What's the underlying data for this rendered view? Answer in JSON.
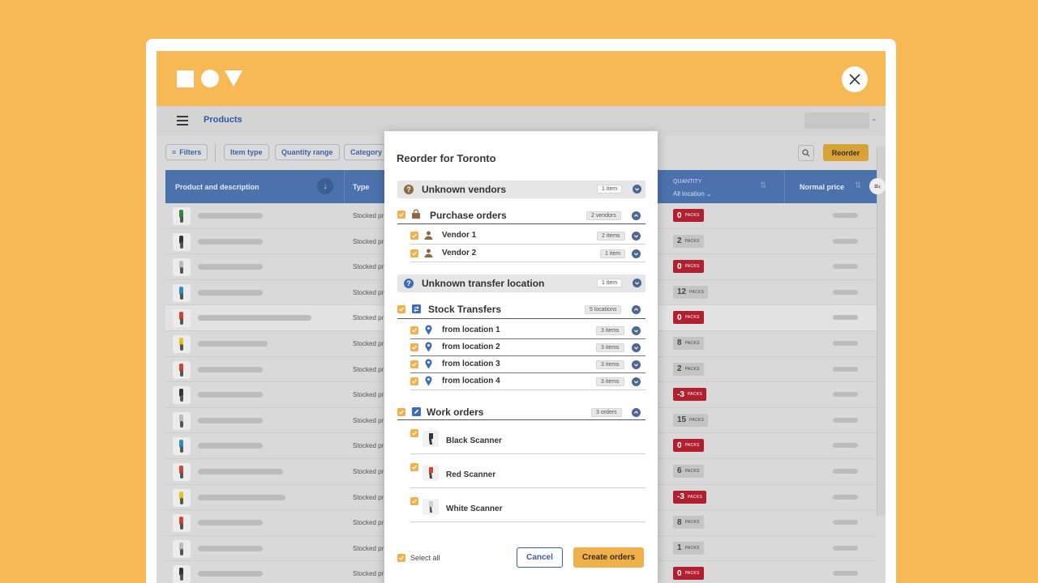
{
  "app": {
    "page_title": "Products"
  },
  "filters": {
    "filters_label": "Filters",
    "item_type_label": "Item type",
    "quantity_range_label": "Quantity range",
    "category_label": "Category",
    "reorder_label": "Reorder"
  },
  "table": {
    "col_product": "Product and description",
    "col_type": "Type",
    "col_quantity_small": "QUANTITY",
    "col_quantity_main": "All location",
    "col_price": "Normal price",
    "pack_unit": "PACKS",
    "rows": [
      {
        "type": "Stocked pr",
        "qty": "0",
        "status": "red",
        "color": "#2e8b3e"
      },
      {
        "type": "Stocked pr",
        "qty": "2",
        "status": "gray",
        "color": "#333333"
      },
      {
        "type": "Stocked pr",
        "qty": "0",
        "status": "red",
        "color": "#bbbbbb"
      },
      {
        "type": "Stocked pr",
        "qty": "12",
        "status": "gray",
        "color": "#2d8fc9"
      },
      {
        "type": "Stocked pr",
        "qty": "0",
        "status": "red",
        "color": "#d8432c"
      },
      {
        "type": "Stocked pr",
        "qty": "8",
        "status": "gray",
        "color": "#e6c21c"
      },
      {
        "type": "Stocked pr",
        "qty": "2",
        "status": "gray",
        "color": "#d8432c"
      },
      {
        "type": "Stocked pr",
        "qty": "-3",
        "status": "red",
        "color": "#333333"
      },
      {
        "type": "Stocked pr",
        "qty": "15",
        "status": "gray",
        "color": "#bbbbbb"
      },
      {
        "type": "Stocked pr",
        "qty": "0",
        "status": "red",
        "color": "#2d8fc9"
      },
      {
        "type": "Stocked pr",
        "qty": "6",
        "status": "gray",
        "color": "#d8432c"
      },
      {
        "type": "Stocked pr",
        "qty": "-3",
        "status": "red",
        "color": "#e6c21c"
      },
      {
        "type": "Stocked pr",
        "qty": "8",
        "status": "gray",
        "color": "#d8432c"
      },
      {
        "type": "Stocked pr",
        "qty": "1",
        "status": "gray",
        "color": "#bbbbbb"
      },
      {
        "type": "Stocked pr",
        "qty": "0",
        "status": "red",
        "color": "#333333"
      }
    ]
  },
  "modal": {
    "title": "Reorder for Toronto",
    "unknown_vendors": {
      "label": "Unknown vendors",
      "badge": "1 item"
    },
    "purchase_orders": {
      "label": "Purchase orders",
      "badge": "2 vendors"
    },
    "vendors": [
      {
        "label": "Vendor 1",
        "badge": "2 items"
      },
      {
        "label": "Vendor 2",
        "badge": "1 item"
      }
    ],
    "unknown_transfer": {
      "label": "Unknown transfer location",
      "badge": "1 item"
    },
    "stock_transfers": {
      "label": "Stock Transfers",
      "badge": "5 locations"
    },
    "locations": [
      {
        "label": "from location 1",
        "badge": "3 items"
      },
      {
        "label": "from location 2",
        "badge": "3 items"
      },
      {
        "label": "from location 3",
        "badge": "3 items"
      },
      {
        "label": "from location 4",
        "badge": "3 items"
      }
    ],
    "work_orders": {
      "label": "Work orders",
      "badge": "3 orders"
    },
    "products": [
      {
        "label": "Black Scanner",
        "color": "#333333"
      },
      {
        "label": "Red Scanner",
        "color": "#d8432c"
      },
      {
        "label": "White Scanner",
        "color": "#cfcfcf"
      }
    ],
    "select_all_label": "Select all",
    "cancel_label": "Cancel",
    "create_label": "Create orders"
  },
  "colors": {
    "accent_orange": "#f7b955",
    "table_header_blue": "#4b72ad",
    "danger_red": "#b0202e",
    "checkbox_orange": "#f0b04c"
  }
}
